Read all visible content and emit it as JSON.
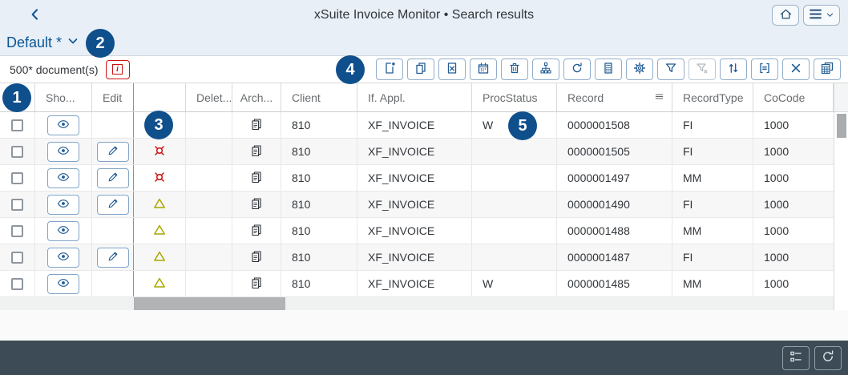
{
  "header": {
    "title": "xSuite Invoice Monitor • Search results",
    "icon_names": [
      "back-chevron",
      "home",
      "menu-hamburger",
      "chevron-down"
    ]
  },
  "variant": {
    "name": "Default *",
    "icon": "chevron-down"
  },
  "toolbar": {
    "count": "500* document(s)",
    "info_icon": "i",
    "buttons": [
      {
        "icon": "add-document",
        "disabled": false
      },
      {
        "icon": "copy",
        "disabled": false
      },
      {
        "icon": "export-excel",
        "disabled": false
      },
      {
        "icon": "calendar",
        "disabled": false
      },
      {
        "icon": "delete-trash",
        "disabled": false
      },
      {
        "icon": "hierarchy",
        "disabled": false
      },
      {
        "icon": "refresh",
        "disabled": false
      },
      {
        "icon": "calculator",
        "disabled": false
      },
      {
        "icon": "settings-gear",
        "disabled": false
      },
      {
        "icon": "filter",
        "disabled": false
      },
      {
        "icon": "clear-filter",
        "disabled": true
      },
      {
        "icon": "sort",
        "disabled": false
      },
      {
        "icon": "legend",
        "disabled": false
      },
      {
        "icon": "close",
        "disabled": false
      },
      {
        "icon": "export-table",
        "disabled": false
      }
    ]
  },
  "annotations": [
    "1",
    "2",
    "3",
    "4",
    "5"
  ],
  "table": {
    "columns": [
      "",
      "Sho...",
      "Edit",
      "",
      "Delet...",
      "Arch...",
      "Client",
      "If. Appl.",
      "ProcStatus",
      "Record",
      "RecordType",
      "CoCode"
    ],
    "record_header_icon": "sort-lines",
    "rows": [
      {
        "show": true,
        "edit": false,
        "status": "",
        "archive": true,
        "client": "810",
        "if_appl": "XF_INVOICE",
        "proc_status": "W",
        "record": "0000001508",
        "record_type": "FI",
        "co_code": "1000"
      },
      {
        "show": true,
        "edit": true,
        "status": "error",
        "archive": true,
        "client": "810",
        "if_appl": "XF_INVOICE",
        "proc_status": "",
        "record": "0000001505",
        "record_type": "FI",
        "co_code": "1000"
      },
      {
        "show": true,
        "edit": true,
        "status": "error",
        "archive": true,
        "client": "810",
        "if_appl": "XF_INVOICE",
        "proc_status": "",
        "record": "0000001497",
        "record_type": "MM",
        "co_code": "1000"
      },
      {
        "show": true,
        "edit": true,
        "status": "warning",
        "archive": true,
        "client": "810",
        "if_appl": "XF_INVOICE",
        "proc_status": "",
        "record": "0000001490",
        "record_type": "FI",
        "co_code": "1000"
      },
      {
        "show": true,
        "edit": false,
        "status": "warning",
        "archive": true,
        "client": "810",
        "if_appl": "XF_INVOICE",
        "proc_status": "",
        "record": "0000001488",
        "record_type": "MM",
        "co_code": "1000"
      },
      {
        "show": true,
        "edit": true,
        "status": "warning",
        "archive": true,
        "client": "810",
        "if_appl": "XF_INVOICE",
        "proc_status": "",
        "record": "0000001487",
        "record_type": "FI",
        "co_code": "1000"
      },
      {
        "show": true,
        "edit": false,
        "status": "warning",
        "archive": true,
        "client": "810",
        "if_appl": "XF_INVOICE",
        "proc_status": "W",
        "record": "0000001485",
        "record_type": "MM",
        "co_code": "1000"
      }
    ]
  },
  "footer": {
    "buttons": [
      {
        "icon": "legend-list"
      },
      {
        "icon": "refresh"
      }
    ]
  },
  "colors": {
    "accent_blue": "#1f5a93",
    "badge_blue": "#0f4f8c",
    "error_red": "#cc1111",
    "warning_yellow": "#a8a700",
    "shell_bg": "#e9eff6",
    "footer_bg": "#3c4b55"
  }
}
